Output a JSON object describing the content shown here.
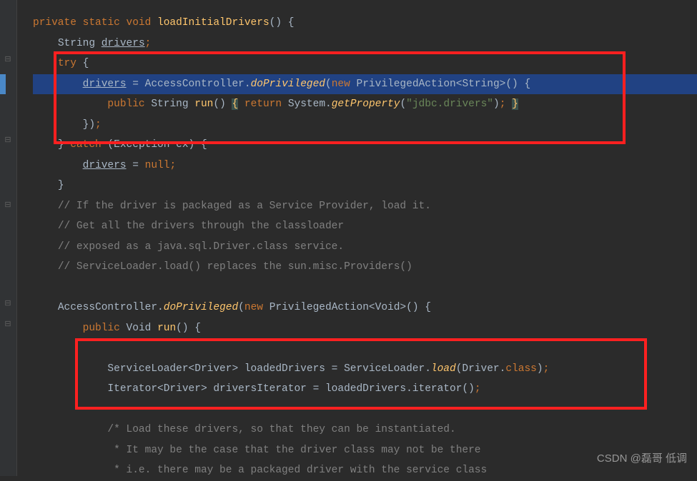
{
  "code": {
    "l1": {
      "kw1": "private static void",
      "method": "loadInitialDrivers",
      "paren": "() {"
    },
    "l2": {
      "type": "String ",
      "var": "drivers",
      "semi": ";"
    },
    "l3": {
      "kw": "try",
      "brace": " {"
    },
    "l4": {
      "var": "drivers",
      "assign": " = AccessController.",
      "method": "doPrivileged",
      "paren1": "(",
      "kw_new": "new ",
      "type": "PrivilegedAction<String>() {"
    },
    "l5": {
      "kw": "public ",
      "type": "String ",
      "method": "run",
      "paren1": "() ",
      "brace1": "{",
      "space1": " ",
      "kw_ret": "return ",
      "call": "System.",
      "method2": "getProperty",
      "paren2": "(",
      "str": "\"jdbc.drivers\"",
      "paren3": ")",
      "semi": ";",
      "space2": " ",
      "brace2": "}"
    },
    "l6": {
      "close": "})",
      "semi": ";"
    },
    "l7": {
      "brace1": "} ",
      "kw": "catch",
      "paren": " (Exception ex) {"
    },
    "l8": {
      "var": "drivers",
      "assign": " = ",
      "kw": "null",
      "semi": ";"
    },
    "l9": {
      "brace": "}"
    },
    "l10": {
      "comment": "// If the driver is packaged as a Service Provider, load it."
    },
    "l11": {
      "comment": "// Get all the drivers through the classloader"
    },
    "l12": {
      "comment": "// exposed as a java.sql.Driver.class service."
    },
    "l13": {
      "comment": "// ServiceLoader.load() replaces the sun.misc.Providers()"
    },
    "l14": {
      "call": "AccessController.",
      "method": "doPrivileged",
      "paren1": "(",
      "kw_new": "new ",
      "type": "PrivilegedAction<Void>() {"
    },
    "l15": {
      "kw": "public ",
      "type": "Void ",
      "method": "run",
      "paren": "() {"
    },
    "l16": {
      "type1": "ServiceLoader<Driver> loadedDrivers = ServiceLoader.",
      "method": "load",
      "paren1": "(Driver.",
      "kw": "class",
      "paren2": ")",
      "semi": ";"
    },
    "l17": {
      "type1": "Iterator<Driver> driversIterator = loadedDrivers.iterator()",
      "semi": ";"
    },
    "l18": {
      "comment": "/* Load these drivers, so that they can be instantiated."
    },
    "l19": {
      "comment": " * It may be the case that the driver class may not be there"
    },
    "l20": {
      "comment": " * i.e. there may be a packaged driver with the service class"
    }
  },
  "watermark": "CSDN @磊哥 低调"
}
